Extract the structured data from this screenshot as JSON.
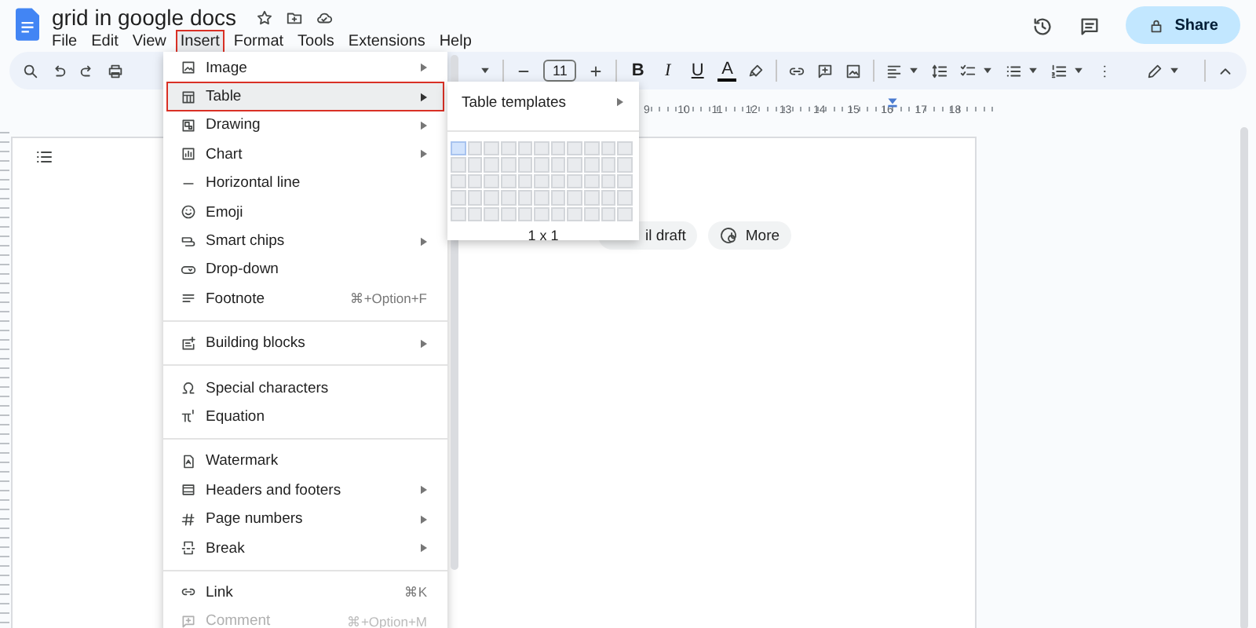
{
  "title": "grid in google docs",
  "menubar": [
    {
      "label": "File",
      "selected": false
    },
    {
      "label": "Edit",
      "selected": false
    },
    {
      "label": "View",
      "selected": false
    },
    {
      "label": "Insert",
      "selected": true
    },
    {
      "label": "Format",
      "selected": false
    },
    {
      "label": "Tools",
      "selected": false
    },
    {
      "label": "Extensions",
      "selected": false
    },
    {
      "label": "Help",
      "selected": false
    }
  ],
  "share_button": "Share",
  "toolbar": {
    "font_size": "11",
    "format_buttons": [
      "B",
      "I",
      "U",
      "A"
    ]
  },
  "ruler": [
    "9",
    "10",
    "11",
    "12",
    "13",
    "14",
    "15",
    "16",
    "17",
    "18"
  ],
  "chips": [
    "il draft",
    "More"
  ],
  "insert_menu": [
    [
      {
        "label": "Image",
        "submenu": true,
        "selected": false,
        "disabled": false
      },
      {
        "label": "Table",
        "submenu": true,
        "selected": true,
        "disabled": false
      },
      {
        "label": "Drawing",
        "submenu": true,
        "selected": false,
        "disabled": false
      },
      {
        "label": "Chart",
        "submenu": true,
        "selected": false,
        "disabled": false
      },
      {
        "label": "Horizontal line",
        "submenu": false,
        "selected": false,
        "disabled": false
      },
      {
        "label": "Emoji",
        "submenu": false,
        "selected": false,
        "disabled": false
      },
      {
        "label": "Smart chips",
        "submenu": true,
        "selected": false,
        "disabled": false
      },
      {
        "label": "Drop-down",
        "submenu": false,
        "selected": false,
        "disabled": false
      },
      {
        "label": "Footnote",
        "shortcut": "⌘+Option+F",
        "submenu": false,
        "selected": false,
        "disabled": false
      }
    ],
    [
      {
        "label": "Building blocks",
        "submenu": true,
        "selected": false,
        "disabled": false
      }
    ],
    [
      {
        "label": "Special characters",
        "submenu": false,
        "selected": false,
        "disabled": false
      },
      {
        "label": "Equation",
        "submenu": false,
        "selected": false,
        "disabled": false
      }
    ],
    [
      {
        "label": "Watermark",
        "submenu": false,
        "selected": false,
        "disabled": false
      },
      {
        "label": "Headers and footers",
        "submenu": true,
        "selected": false,
        "disabled": false
      },
      {
        "label": "Page numbers",
        "submenu": true,
        "selected": false,
        "disabled": false
      },
      {
        "label": "Break",
        "submenu": true,
        "selected": false,
        "disabled": false
      }
    ],
    [
      {
        "label": "Link",
        "shortcut": "⌘K",
        "submenu": false,
        "selected": false,
        "disabled": false
      },
      {
        "label": "Comment",
        "shortcut": "⌘+Option+M",
        "submenu": false,
        "selected": false,
        "disabled": true
      }
    ]
  ],
  "table_submenu": {
    "templates": "Table templates",
    "size_label": "1 x 1",
    "grid": [
      [
        {
          "selected": true
        },
        {
          "selected": false
        },
        {
          "selected": false
        },
        {
          "selected": false
        },
        {
          "selected": false
        },
        {
          "selected": false
        },
        {
          "selected": false
        },
        {
          "selected": false
        },
        {
          "selected": false
        },
        {
          "selected": false
        },
        {
          "selected": false
        }
      ],
      [
        {
          "selected": false
        },
        {
          "selected": false
        },
        {
          "selected": false
        },
        {
          "selected": false
        },
        {
          "selected": false
        },
        {
          "selected": false
        },
        {
          "selected": false
        },
        {
          "selected": false
        },
        {
          "selected": false
        },
        {
          "selected": false
        },
        {
          "selected": false
        }
      ],
      [
        {
          "selected": false
        },
        {
          "selected": false
        },
        {
          "selected": false
        },
        {
          "selected": false
        },
        {
          "selected": false
        },
        {
          "selected": false
        },
        {
          "selected": false
        },
        {
          "selected": false
        },
        {
          "selected": false
        },
        {
          "selected": false
        },
        {
          "selected": false
        }
      ],
      [
        {
          "selected": false
        },
        {
          "selected": false
        },
        {
          "selected": false
        },
        {
          "selected": false
        },
        {
          "selected": false
        },
        {
          "selected": false
        },
        {
          "selected": false
        },
        {
          "selected": false
        },
        {
          "selected": false
        },
        {
          "selected": false
        },
        {
          "selected": false
        }
      ],
      [
        {
          "selected": false
        },
        {
          "selected": false
        },
        {
          "selected": false
        },
        {
          "selected": false
        },
        {
          "selected": false
        },
        {
          "selected": false
        },
        {
          "selected": false
        },
        {
          "selected": false
        },
        {
          "selected": false
        },
        {
          "selected": false
        },
        {
          "selected": false
        }
      ]
    ]
  }
}
